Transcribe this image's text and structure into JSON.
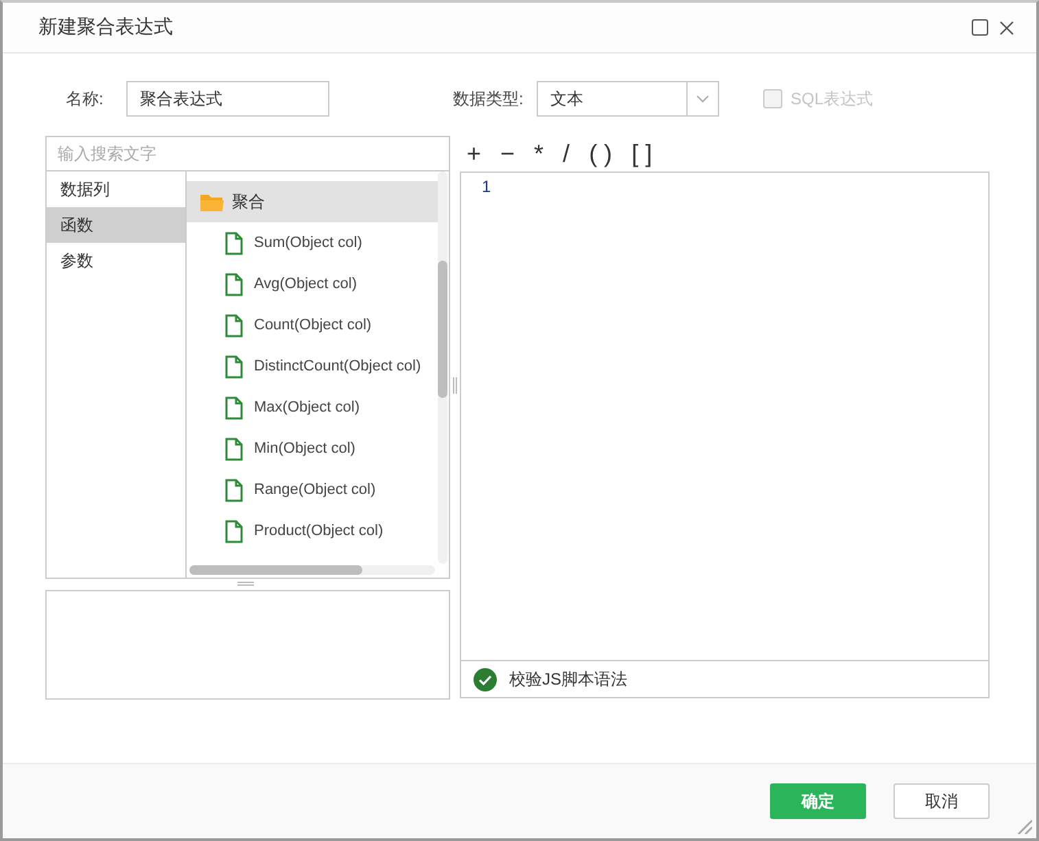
{
  "window": {
    "title": "新建聚合表达式"
  },
  "form": {
    "name": {
      "label": "名称:",
      "value": "聚合表达式"
    },
    "data_type": {
      "label": "数据类型:",
      "value": "文本"
    },
    "sql": {
      "label": "SQL表达式",
      "checked": false,
      "disabled": true
    }
  },
  "search": {
    "placeholder": "输入搜索文字"
  },
  "categories": [
    {
      "label": "数据列",
      "selected": false
    },
    {
      "label": "函数",
      "selected": true
    },
    {
      "label": "参数",
      "selected": false
    }
  ],
  "function_tree": {
    "label": "聚合",
    "expanded": true,
    "selected": true,
    "children": [
      {
        "label": "Sum(Object col)"
      },
      {
        "label": "Avg(Object col)"
      },
      {
        "label": "Count(Object col)"
      },
      {
        "label": "DistinctCount(Object col)"
      },
      {
        "label": "Max(Object col)"
      },
      {
        "label": "Min(Object col)"
      },
      {
        "label": "Range(Object col)"
      },
      {
        "label": "Product(Object col)"
      }
    ]
  },
  "operators": [
    "+",
    "−",
    "*",
    "/",
    "( )",
    "[ ]"
  ],
  "editor": {
    "line_numbers": [
      "1"
    ]
  },
  "validate": {
    "label": "校验JS脚本语法"
  },
  "buttons": [
    {
      "label": "确定",
      "kind": "primary"
    },
    {
      "label": "取消",
      "kind": "secondary"
    }
  ]
}
